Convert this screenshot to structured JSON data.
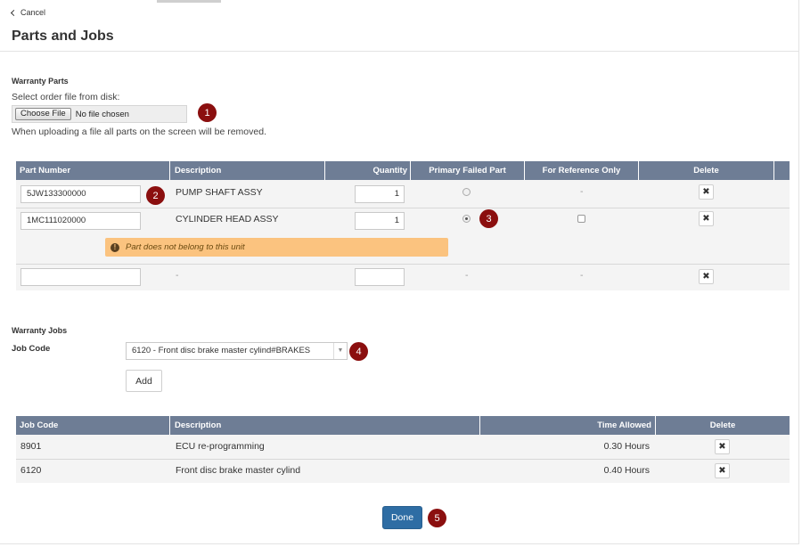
{
  "header": {
    "cancel_label": "Cancel",
    "title": "Parts and Jobs"
  },
  "warranty_parts": {
    "section_title": "Warranty Parts",
    "select_file_label": "Select order file from disk:",
    "choose_file_button": "Choose File",
    "file_status": "No file chosen",
    "upload_note": "When uploading a file all parts on the screen will be removed.",
    "columns": [
      "Part Number",
      "Description",
      "Quantity",
      "Primary Failed Part",
      "For Reference Only",
      "Delete"
    ],
    "rows": [
      {
        "part_number": "5JW133300000",
        "description": "PUMP SHAFT ASSY",
        "quantity": "1",
        "primary_failed": false,
        "for_reference": "-"
      },
      {
        "part_number": "1MC111020000",
        "description": "CYLINDER HEAD ASSY",
        "quantity": "1",
        "primary_failed": true,
        "for_reference": ""
      },
      {
        "part_number": "",
        "description": "-",
        "quantity": "",
        "primary_failed": "-",
        "for_reference": "-"
      }
    ],
    "warning_message": "Part does not belong to this unit",
    "delete_glyph": "✖"
  },
  "warranty_jobs": {
    "section_title": "Warranty Jobs",
    "job_code_label": "Job Code",
    "selected_job": "6120 - Front disc brake master cylind#BRAKES",
    "add_button": "Add",
    "columns": [
      "Job Code",
      "Description",
      "Time Allowed",
      "Delete"
    ],
    "rows": [
      {
        "job_code": "8901",
        "description": "ECU re-programming",
        "time_allowed": "0.30 Hours"
      },
      {
        "job_code": "6120",
        "description": "Front disc brake master cylind",
        "time_allowed": "0.40 Hours"
      }
    ]
  },
  "footer": {
    "done_button": "Done"
  },
  "callouts": [
    "1",
    "2",
    "3",
    "4",
    "5"
  ],
  "colors": {
    "table_header": "#6e7d95",
    "callout_badge": "#8b0f0f",
    "warning_bg": "#fbc37f",
    "primary_button": "#2e6da4"
  }
}
